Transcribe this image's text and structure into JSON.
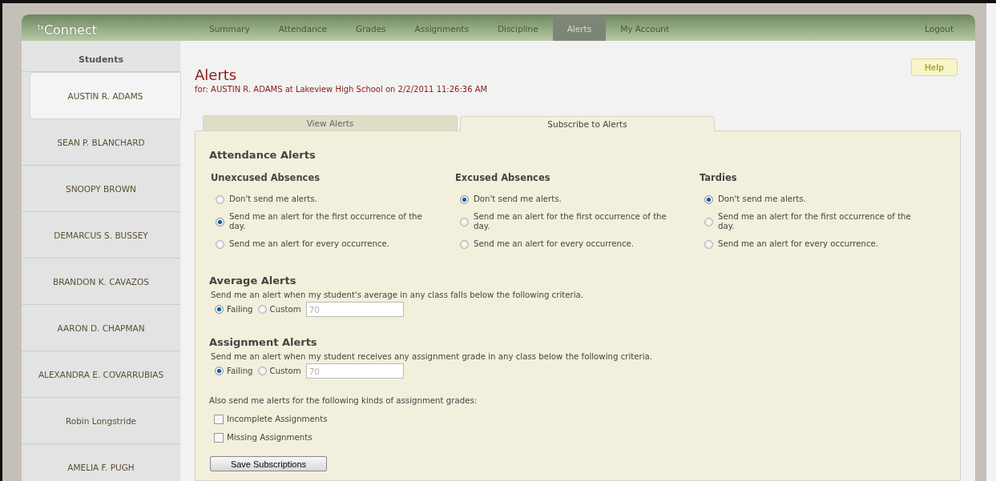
{
  "logo": "$^{tx}$Connect",
  "nav": [
    {
      "label": "Summary",
      "selected": false
    },
    {
      "label": "Attendance",
      "selected": false
    },
    {
      "label": "Grades",
      "selected": false
    },
    {
      "label": "Assignments",
      "selected": false
    },
    {
      "label": "Discipline",
      "selected": false
    },
    {
      "label": "Alerts",
      "selected": true
    },
    {
      "label": "My Account",
      "selected": false
    }
  ],
  "logout": "Logout",
  "sidebar": {
    "heading": "Students",
    "students": [
      {
        "name": "AUSTIN R. ADAMS",
        "selected": true
      },
      {
        "name": "SEAN P. BLANCHARD",
        "selected": false
      },
      {
        "name": "SNOOPY BROWN",
        "selected": false
      },
      {
        "name": "DEMARCUS S. BUSSEY",
        "selected": false
      },
      {
        "name": "BRANDON K. CAVAZOS",
        "selected": false
      },
      {
        "name": "AARON D. CHAPMAN",
        "selected": false
      },
      {
        "name": "ALEXANDRA E. COVARRUBIAS",
        "selected": false
      },
      {
        "name": "Robin Longstride",
        "selected": false
      },
      {
        "name": "AMELIA F. PUGH",
        "selected": false
      }
    ]
  },
  "page": {
    "title": "Alerts",
    "subtitle": "for: AUSTIN R. ADAMS at Lakeview High School on 2/2/2011 11:26:36 AM",
    "help": "Help"
  },
  "tabs": [
    {
      "label": "View Alerts",
      "selected": false
    },
    {
      "label": "Subscribe to Alerts",
      "selected": true
    }
  ],
  "attendance": {
    "heading": "Attendance Alerts",
    "groups": [
      {
        "title": "Unexcused Absences",
        "options": [
          {
            "label": "Don't send me alerts.",
            "selected": false
          },
          {
            "label": "Send me an alert for the first occurrence of the day.",
            "selected": true
          },
          {
            "label": "Send me an alert for every occurrence.",
            "selected": false
          }
        ]
      },
      {
        "title": "Excused Absences",
        "options": [
          {
            "label": "Don't send me alerts.",
            "selected": true
          },
          {
            "label": "Send me an alert for the first occurrence of the day.",
            "selected": false
          },
          {
            "label": "Send me an alert for every occurrence.",
            "selected": false
          }
        ]
      },
      {
        "title": "Tardies",
        "options": [
          {
            "label": "Don't send me alerts.",
            "selected": true
          },
          {
            "label": "Send me an alert for the first occurrence of the day.",
            "selected": false
          },
          {
            "label": "Send me an alert for every occurrence.",
            "selected": false
          }
        ]
      }
    ]
  },
  "criteria": [
    {
      "heading": "Average Alerts",
      "description": "Send me an alert when my student's average in any class falls below the following criteria.",
      "options": [
        {
          "label": "Failing",
          "selected": true
        },
        {
          "label": "Custom",
          "selected": false
        }
      ],
      "custom_field": {
        "value": "70",
        "disabled": true
      }
    },
    {
      "heading": "Assignment Alerts",
      "description": "Send me an alert when my student receives any assignment grade in any class below the following criteria.",
      "options": [
        {
          "label": "Failing",
          "selected": true
        },
        {
          "label": "Custom",
          "selected": false
        }
      ],
      "custom_field": {
        "value": "70",
        "disabled": true
      }
    }
  ],
  "extra": {
    "description": "Also send me alerts for the following kinds of assignment grades:",
    "checkboxes": [
      {
        "label": "Incomplete Assignments",
        "checked": false
      },
      {
        "label": "Missing Assignments",
        "checked": false
      }
    ]
  },
  "save_button": "Save Subscriptions"
}
